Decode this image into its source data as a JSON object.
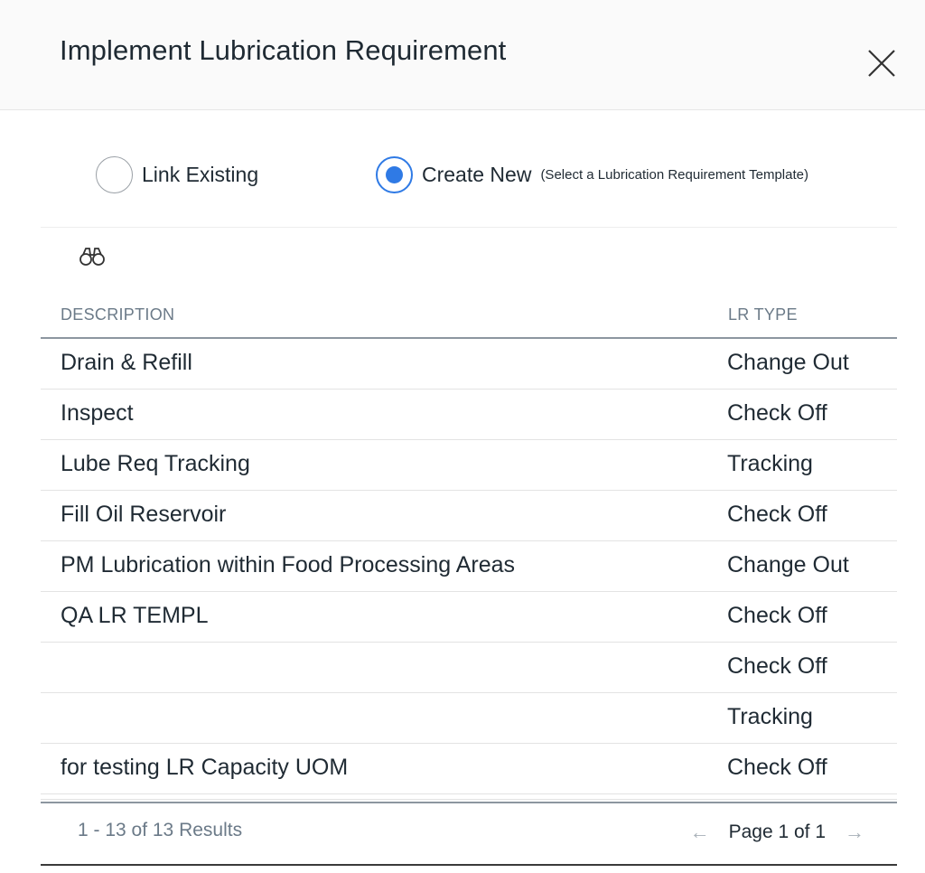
{
  "dialog": {
    "title": "Implement Lubrication Requirement"
  },
  "mode": {
    "link_existing_label": "Link Existing",
    "link_existing_selected": false,
    "create_new_label": "Create New",
    "create_new_hint": "(Select a Lubrication Requirement Template)",
    "create_new_selected": true
  },
  "icons": {
    "search": "binoculars-icon",
    "close": "close-icon",
    "prev": "arrow-left-icon",
    "next": "arrow-right-icon"
  },
  "table": {
    "columns": [
      "DESCRIPTION",
      "LR TYPE"
    ],
    "rows": [
      {
        "description": "Drain & Refill",
        "lr_type": "Change Out"
      },
      {
        "description": "Inspect",
        "lr_type": "Check Off"
      },
      {
        "description": "Lube Req Tracking",
        "lr_type": "Tracking"
      },
      {
        "description": "Fill Oil Reservoir",
        "lr_type": "Check Off"
      },
      {
        "description": "PM Lubrication within Food Processing Areas",
        "lr_type": "Change Out"
      },
      {
        "description": "QA LR TEMPL",
        "lr_type": "Check Off"
      },
      {
        "description": "",
        "lr_type": "Check Off"
      },
      {
        "description": "",
        "lr_type": "Tracking"
      },
      {
        "description": "for testing LR Capacity UOM",
        "lr_type": "Check Off"
      }
    ]
  },
  "footer": {
    "results_text": "1 - 13 of 13 Results",
    "page_text": "Page 1 of 1",
    "prev_arrow": "←",
    "next_arrow": "→"
  },
  "colors": {
    "accent": "#2f7ae5",
    "muted_text": "#6b7a88",
    "text": "#1f2a33"
  }
}
